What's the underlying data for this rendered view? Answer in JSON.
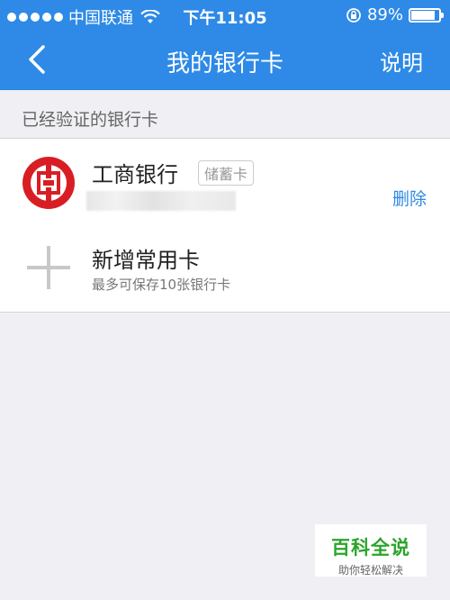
{
  "status_bar": {
    "carrier": "中国联通",
    "time": "下午11:05",
    "battery_text": "89%",
    "battery_level": 0.89,
    "icons": [
      "signal-dots-icon",
      "wifi-icon",
      "rotation-lock-icon",
      "battery-icon"
    ]
  },
  "navbar": {
    "back_icon": "chevron-left-icon",
    "title": "我的银行卡",
    "right_label": "说明"
  },
  "section": {
    "label": "已经验证的银行卡"
  },
  "bank_card": {
    "logo_icon": "icbc-logo-icon",
    "name": "工商银行",
    "type": "储蓄卡",
    "delete_label": "删除"
  },
  "add_card": {
    "icon": "plus-icon",
    "title": "新增常用卡",
    "subtitle": "最多可保存10张银行卡"
  },
  "watermark": {
    "title": "百科全说",
    "subtitle": "助你轻松解决"
  },
  "colors": {
    "accent": "#2e8ae6",
    "background": "#efeff4",
    "icbc_red": "#d81e24",
    "watermark_green": "#2aa52a"
  }
}
